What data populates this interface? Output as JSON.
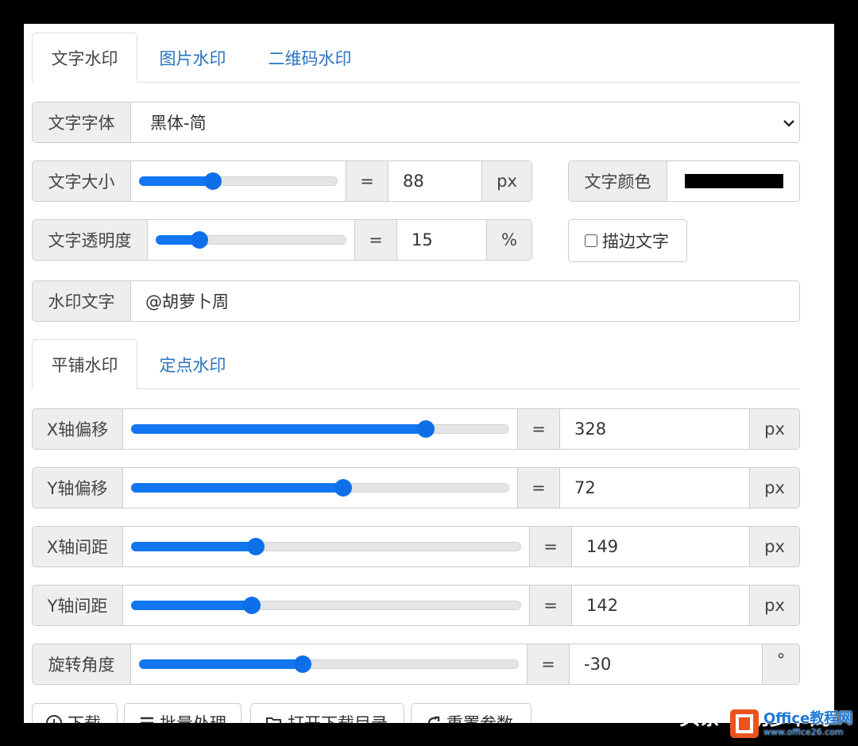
{
  "tabs_top": [
    "文字水印",
    "图片水印",
    "二维码水印"
  ],
  "font_group": {
    "label": "文字字体",
    "value": "黑体-简"
  },
  "size_group": {
    "label": "文字大小",
    "eq": "=",
    "value": "88",
    "unit": "px",
    "slider_value": 0.37
  },
  "color_group": {
    "label": "文字颜色",
    "color": "#000000"
  },
  "opacity_group": {
    "label": "文字透明度",
    "eq": "=",
    "value": "15",
    "unit": "%",
    "slider_value": 0.23
  },
  "stroke_checkbox": {
    "label": "描边文字",
    "checked": false
  },
  "text_group": {
    "label": "水印文字",
    "value": "@胡萝卜周"
  },
  "tabs_mode": [
    "平铺水印",
    "定点水印"
  ],
  "sliders": [
    {
      "label": "X轴偏移",
      "eq": "=",
      "value": "328",
      "unit": "px",
      "slider_value": 0.78
    },
    {
      "label": "Y轴偏移",
      "eq": "=",
      "value": "72",
      "unit": "px",
      "slider_value": 0.56
    },
    {
      "label": "X轴间距",
      "eq": "=",
      "value": "149",
      "unit": "px",
      "slider_value": 0.32
    },
    {
      "label": "Y轴间距",
      "eq": "=",
      "value": "142",
      "unit": "px",
      "slider_value": 0.31
    },
    {
      "label": "旋转角度",
      "eq": "=",
      "value": "-30",
      "unit": "°",
      "slider_value": 0.43
    }
  ],
  "bottom_buttons": [
    "下载",
    "批量处理",
    "打开下载目录",
    "重置参数"
  ],
  "watermark": {
    "text": "头条 @胡萝卜周",
    "logo_text": "Office教程网",
    "logo_url": "www.office26.com"
  },
  "colors": {
    "accent": "#1176f0",
    "link": "#2a73c2",
    "addon_bg": "#eeeeee",
    "border": "#cccccc"
  }
}
